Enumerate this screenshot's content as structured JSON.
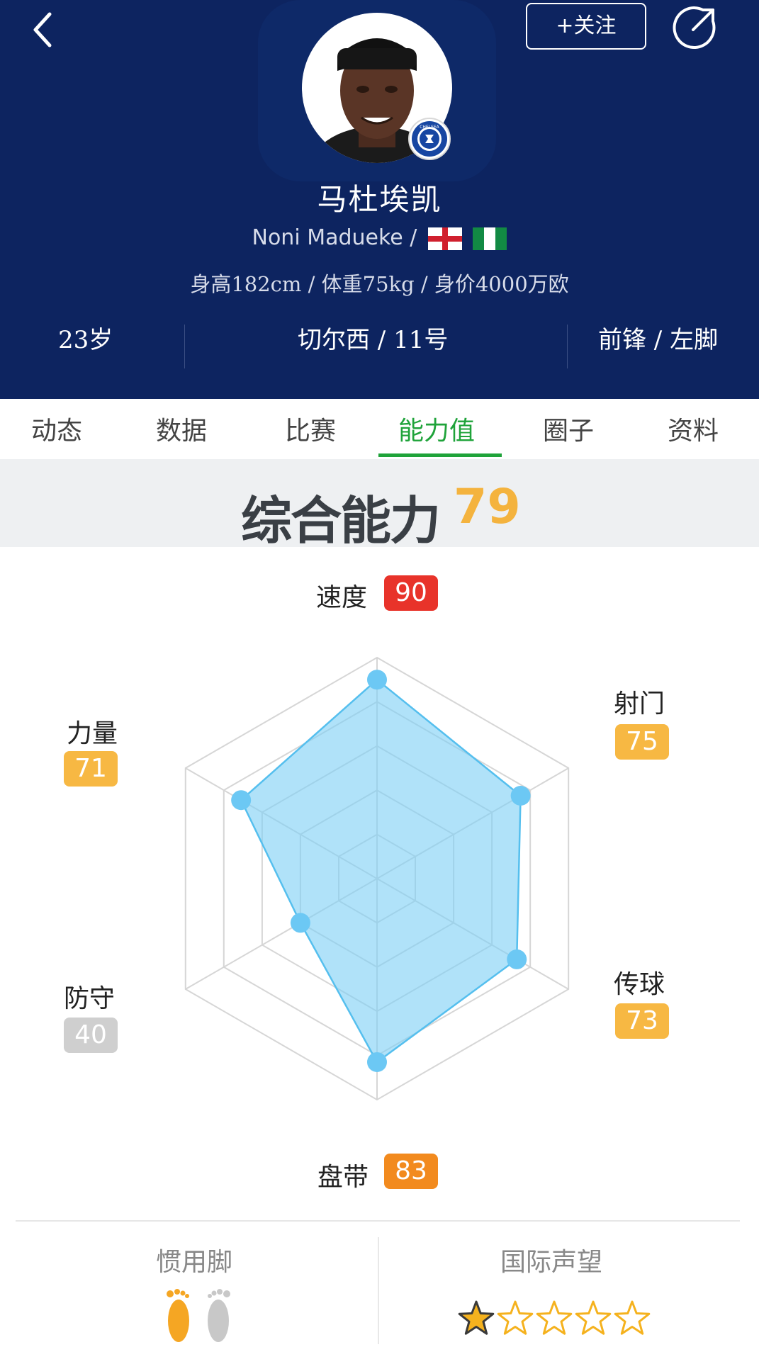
{
  "header": {
    "follow_label": "+关注",
    "name_cn": "马杜埃凯",
    "name_en": "Noni Madueke /",
    "bio": "身高182cm / 体重75kg / 身价4000万欧",
    "age": "23岁",
    "club_number": "切尔西 / 11号",
    "position_foot": "前锋 / 左脚",
    "club_badge_text": "CHELSEA"
  },
  "tabs": [
    {
      "label": "动态"
    },
    {
      "label": "数据"
    },
    {
      "label": "比赛"
    },
    {
      "label": "能力值",
      "active": true
    },
    {
      "label": "圈子"
    },
    {
      "label": "资料"
    }
  ],
  "overall": {
    "label": "综合能力",
    "value": "79"
  },
  "chart_data": {
    "type": "radar",
    "axes": [
      "速度",
      "射门",
      "传球",
      "盘带",
      "防守",
      "力量"
    ],
    "values": [
      90,
      75,
      73,
      83,
      40,
      71
    ],
    "max": 100,
    "rings": 5,
    "colors": {
      "fill": "#7fd1f6",
      "stroke": "#55bfee",
      "grid": "#d6d6d6"
    }
  },
  "attributes": {
    "speed": {
      "label": "速度",
      "value": "90",
      "color": "#e8332a"
    },
    "shooting": {
      "label": "射门",
      "value": "75",
      "color": "#f7b843"
    },
    "passing": {
      "label": "传球",
      "value": "73",
      "color": "#f7b843"
    },
    "dribbling": {
      "label": "盘带",
      "value": "83",
      "color": "#f28a1e"
    },
    "defending": {
      "label": "防守",
      "value": "40",
      "color": "#cfcfcf"
    },
    "strength": {
      "label": "力量",
      "value": "71",
      "color": "#f7b843"
    }
  },
  "footer": {
    "preferred_foot_label": "惯用脚",
    "preferred_foot": "left",
    "reputation_label": "国际声望",
    "reputation_stars": 1,
    "reputation_max": 5
  }
}
